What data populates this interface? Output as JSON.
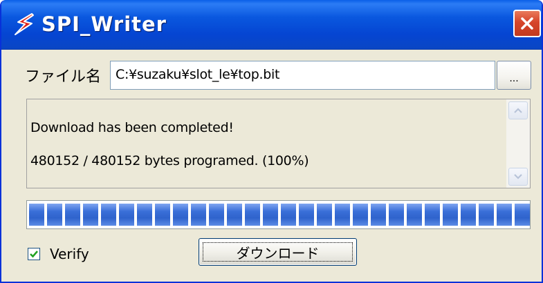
{
  "window": {
    "title": "SPI_Writer",
    "icon": "red-lightning-icon",
    "titlebar_color": "#0a58df"
  },
  "file": {
    "label": "ファイル名",
    "value": "C:¥suzaku¥slot_le¥top.bit",
    "browse_label": "..."
  },
  "log": {
    "lines": [
      "Download has been completed!",
      "480152 / 480152 bytes programed. (100%)"
    ]
  },
  "progress": {
    "fraction": 1.0,
    "color": "#2f63cc"
  },
  "verify": {
    "label": "Verify",
    "checked": true
  },
  "download": {
    "label": "ダウンロード"
  }
}
